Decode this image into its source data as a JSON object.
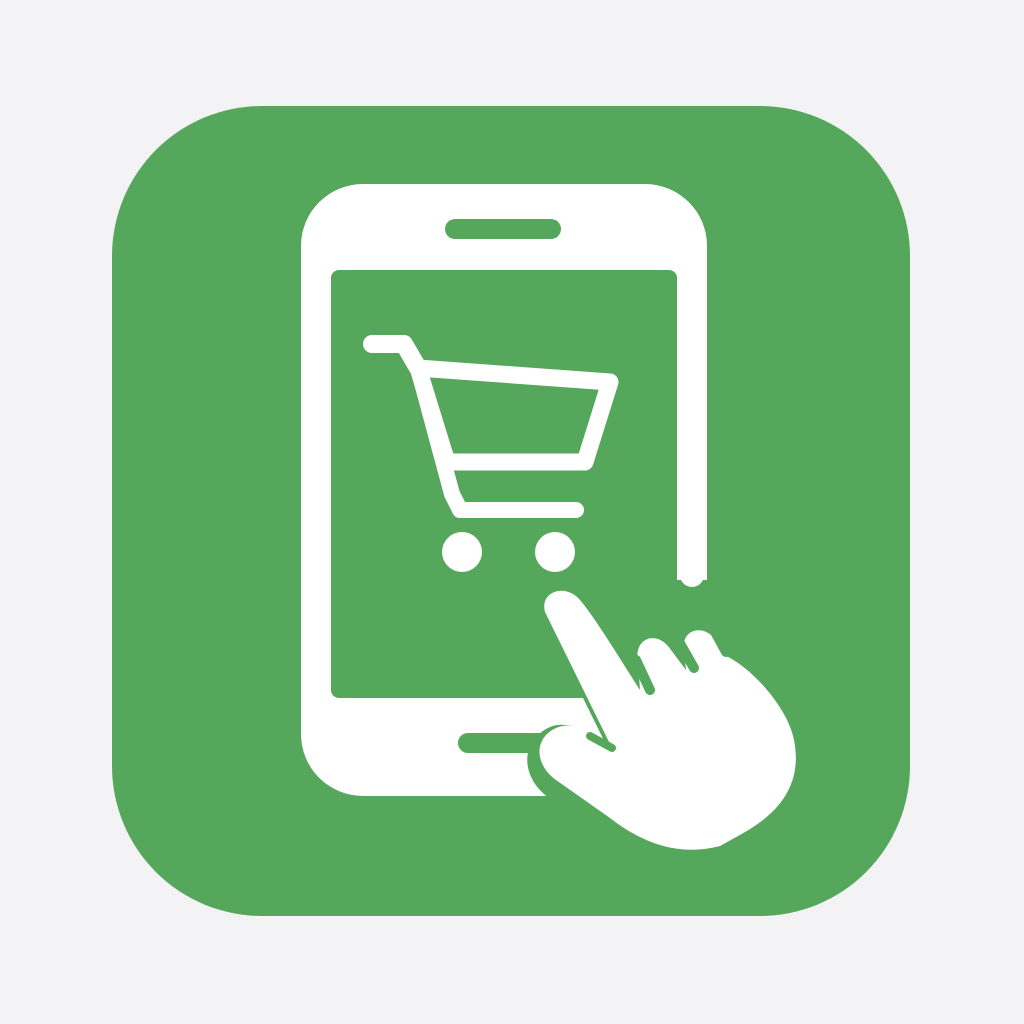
{
  "icon": {
    "name": "mobile-shopping-app-icon",
    "tile_color": "#55a75b",
    "glyph_color": "#ffffff",
    "background_color": "#f3f3f5",
    "parts": [
      "smartphone-icon",
      "shopping-cart-icon",
      "pointing-hand-icon"
    ]
  }
}
